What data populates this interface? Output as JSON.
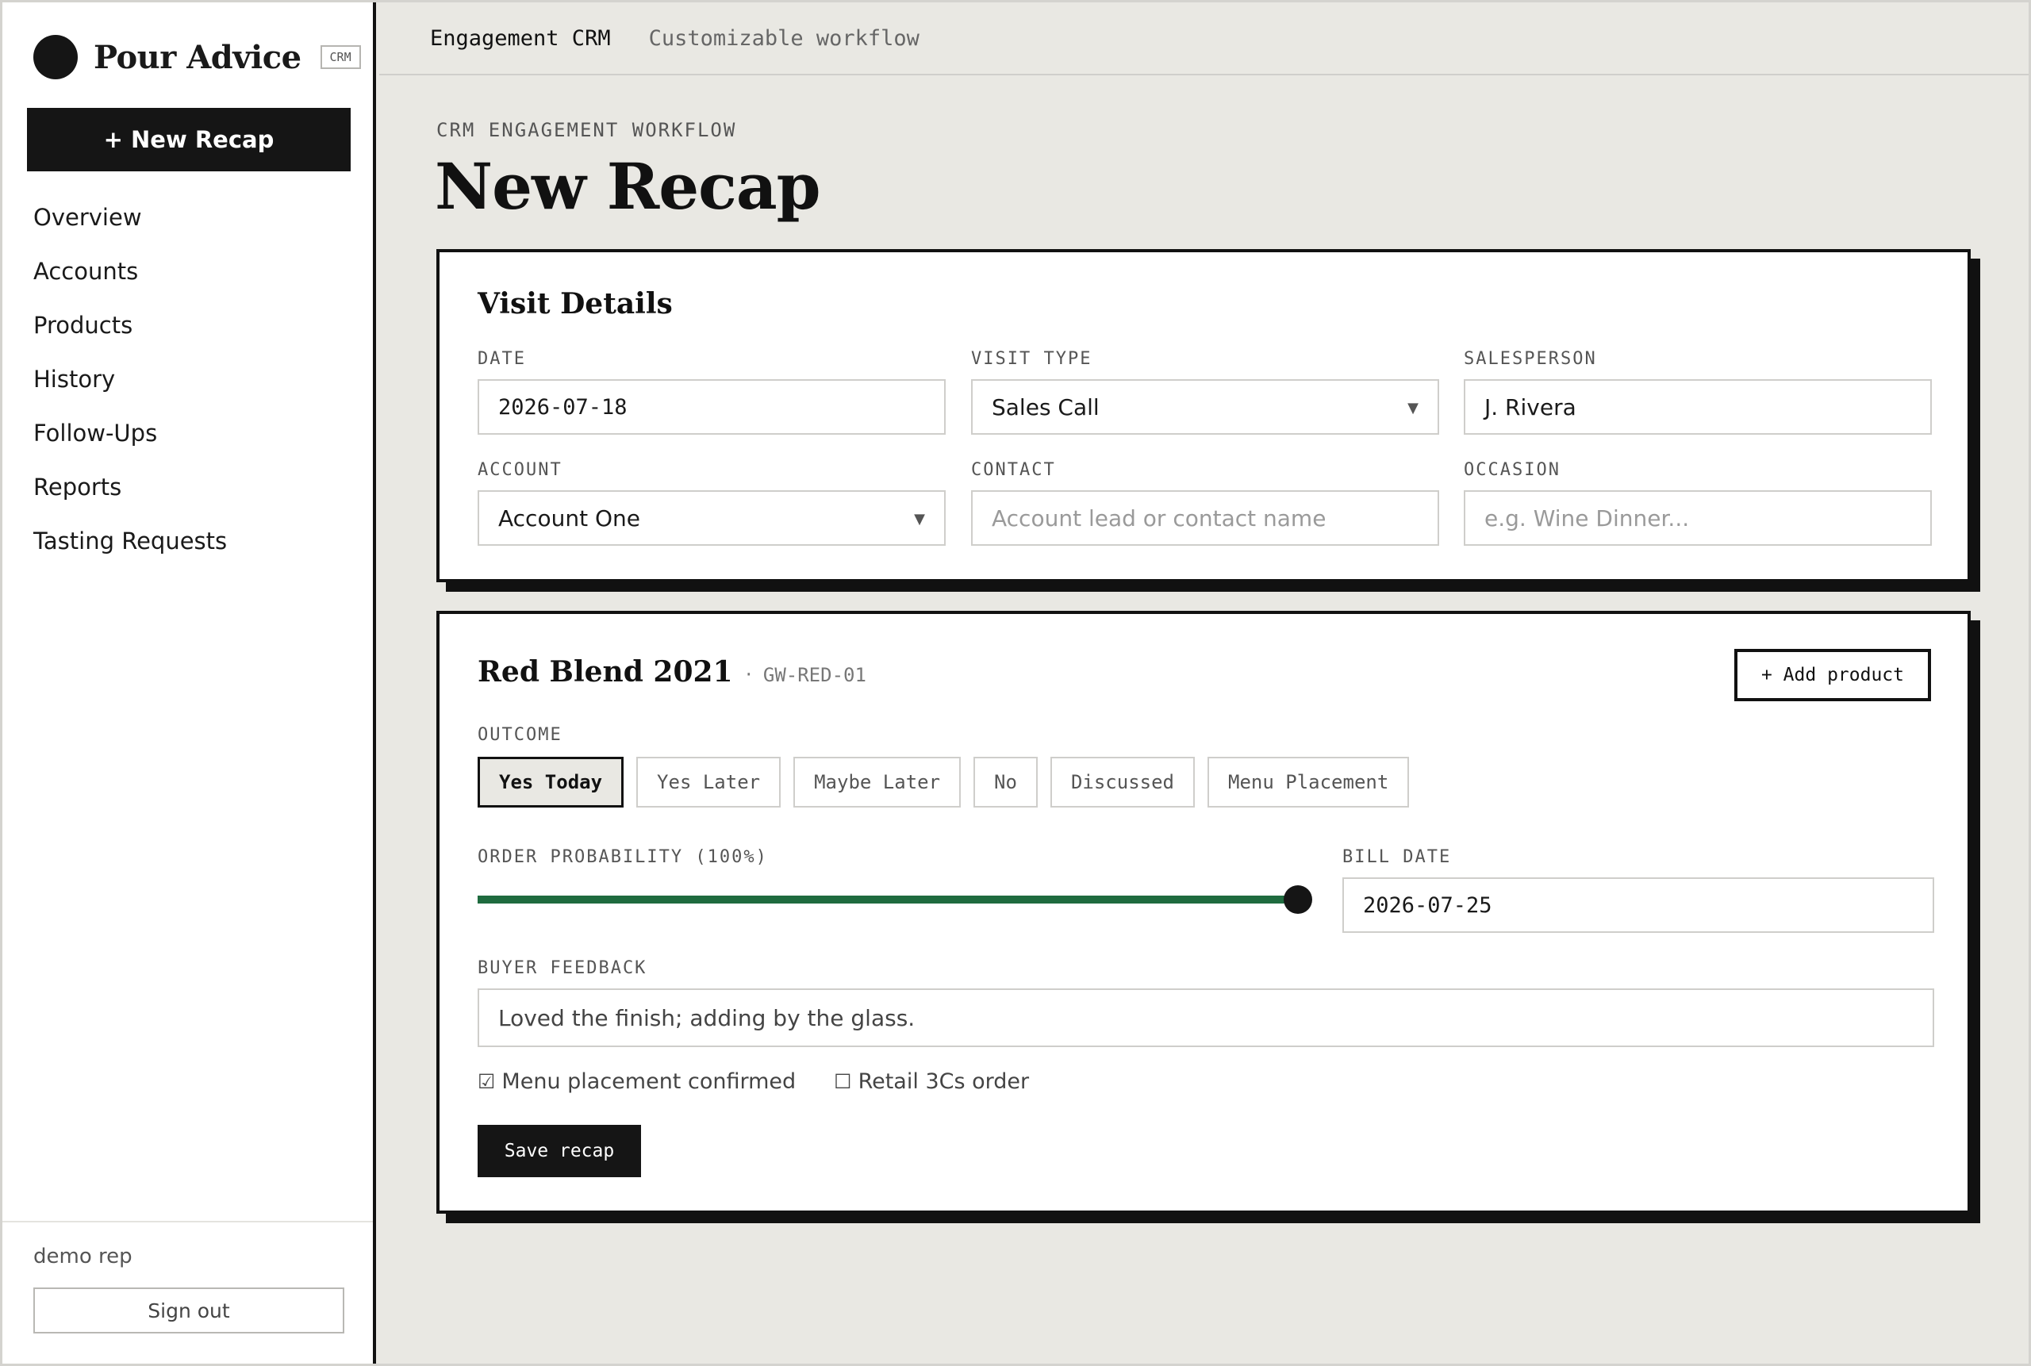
{
  "sidebar": {
    "brand_name": "Pour Advice",
    "brand_badge": "CRM",
    "new_button": "+ New Recap",
    "nav": [
      "Overview",
      "Accounts",
      "Products",
      "History",
      "Follow-Ups",
      "Reports",
      "Tasting Requests"
    ],
    "user": "demo rep",
    "sign_out": "Sign out"
  },
  "topbar": {
    "title": "Engagement CRM",
    "subtitle": "Customizable workflow"
  },
  "page": {
    "eyebrow": "CRM ENGAGEMENT WORKFLOW",
    "title": "New Recap"
  },
  "visit": {
    "title": "Visit Details",
    "date_label": "DATE",
    "date_value": "2026-07-18",
    "visit_type_label": "VISIT TYPE",
    "visit_type_value": "Sales Call",
    "salesperson_label": "SALESPERSON",
    "salesperson_value": "J. Rivera",
    "account_label": "ACCOUNT",
    "account_value": "Account One",
    "contact_label": "CONTACT",
    "contact_placeholder": "Account lead or contact name",
    "occasion_label": "OCCASION",
    "occasion_placeholder": "e.g. Wine Dinner..."
  },
  "product": {
    "name": "Red Blend 2021",
    "separator": "·",
    "sku": "GW-RED-01",
    "add_button": "+ Add product",
    "outcome_label": "OUTCOME",
    "outcomes": [
      "Yes Today",
      "Yes Later",
      "Maybe Later",
      "No",
      "Discussed",
      "Menu Placement"
    ],
    "selected_outcome": "Yes Today",
    "probability_label": "ORDER PROBABILITY (100%)",
    "probability": 100,
    "bill_date_label": "BILL DATE",
    "bill_date_value": "2026-07-25",
    "feedback_label": "BUYER FEEDBACK",
    "feedback_value": "Loved the finish; adding by the glass.",
    "check1_box": "☑",
    "check1_label": "Menu placement confirmed",
    "check2_box": "☐",
    "check2_label": "Retail 3Cs order",
    "save_button": "Save recap"
  },
  "colors": {
    "accent": "#1f6b3f",
    "ink": "#151515",
    "background": "#e9e8e3"
  },
  "icons": {
    "brand": "filled-circle-logo",
    "dropdown": "caret-down-icon"
  }
}
